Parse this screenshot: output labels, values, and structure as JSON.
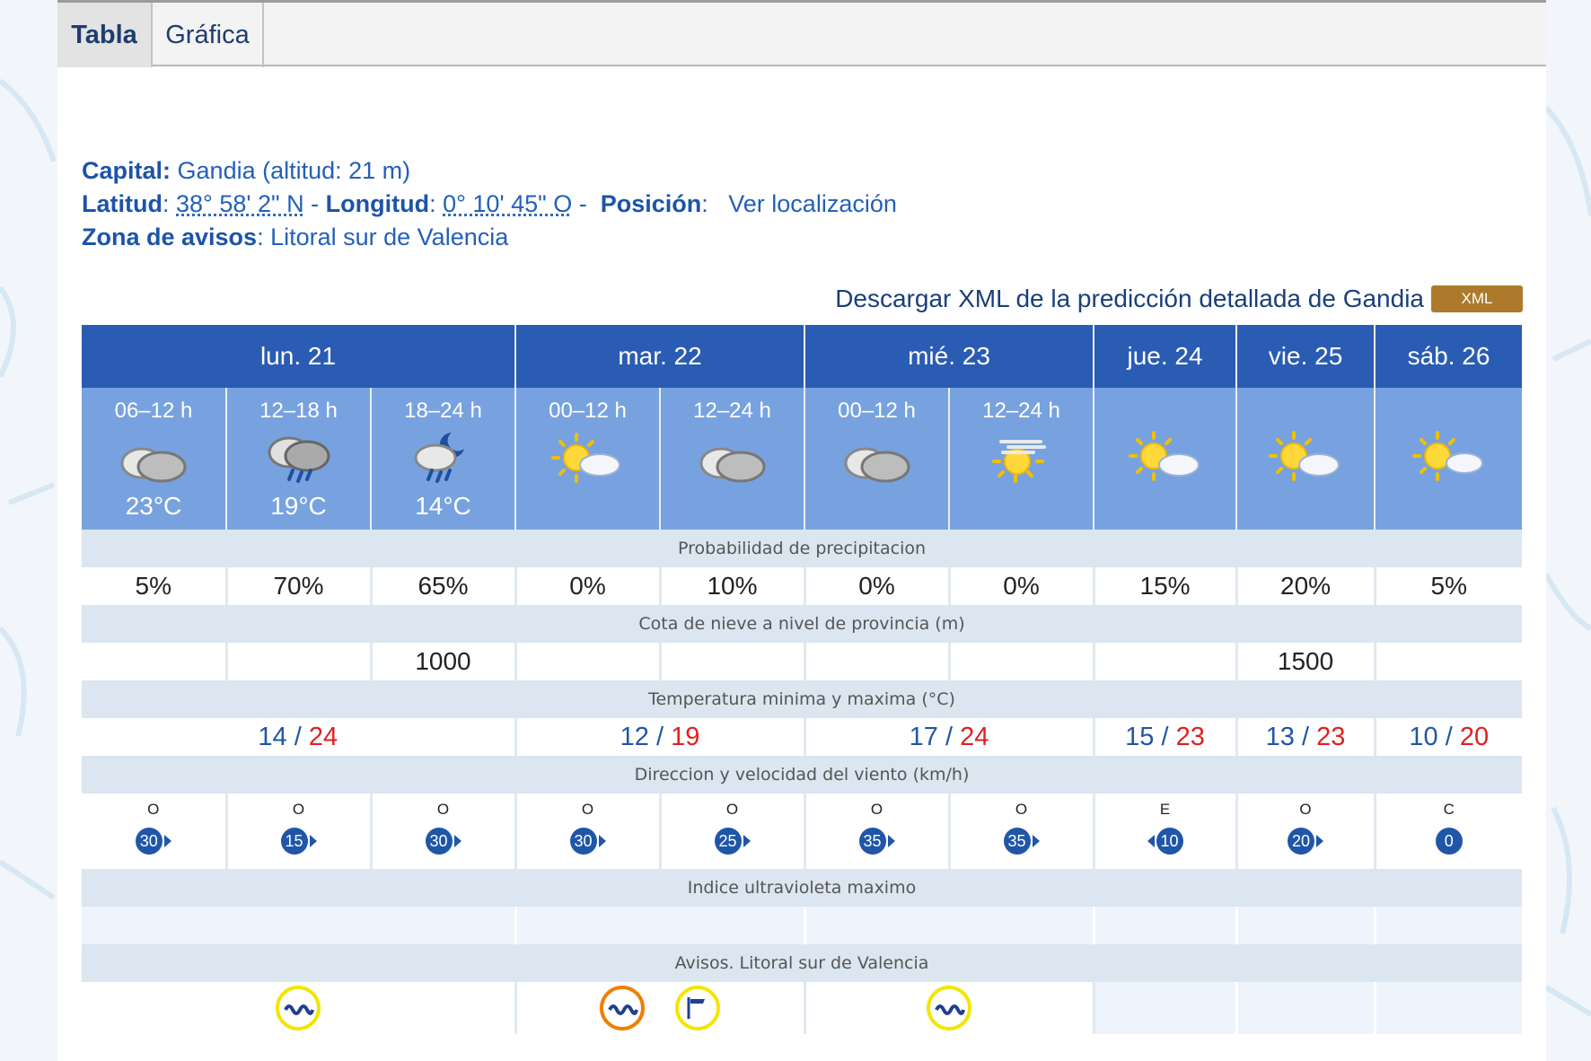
{
  "tabs": [
    {
      "label": "Tabla",
      "active": true
    },
    {
      "label": "Gráfica",
      "active": false
    }
  ],
  "info": {
    "capital_label": "Capital:",
    "capital_value": "Gandia (altitud: 21 m)",
    "latitud_label": "Latitud",
    "latitud_value": "38° 58' 2\" N",
    "longitud_label": "Longitud",
    "longitud_value": "0° 10' 45\" O",
    "posicion_label": "Posición",
    "posicion_link": "Ver localización",
    "zona_label": "Zona de avisos",
    "zona_value": "Litoral sur de Valencia"
  },
  "download": {
    "text": "Descargar XML de la predicción detallada de Gandia",
    "badge": "XML"
  },
  "days": [
    "lun. 21",
    "mar. 22",
    "mié. 23",
    "jue. 24",
    "vie. 25",
    "sáb. 26"
  ],
  "periods": [
    {
      "time": "06–12 h",
      "icon": "cloudy-icon",
      "temp": "23°C"
    },
    {
      "time": "12–18 h",
      "icon": "rain-storm-icon",
      "temp": "19°C"
    },
    {
      "time": "18–24 h",
      "icon": "night-rain-icon",
      "temp": "14°C"
    },
    {
      "time": "00–12 h",
      "icon": "sun-cloud-icon",
      "temp": ""
    },
    {
      "time": "12–24 h",
      "icon": "cloudy-icon",
      "temp": ""
    },
    {
      "time": "00–12 h",
      "icon": "cloudy-icon",
      "temp": ""
    },
    {
      "time": "12–24 h",
      "icon": "sun-haze-icon",
      "temp": ""
    },
    {
      "time": "",
      "icon": "sun-cloud-icon",
      "temp": ""
    },
    {
      "time": "",
      "icon": "sun-cloud-icon",
      "temp": ""
    },
    {
      "time": "",
      "icon": "sun-cloud-icon",
      "temp": ""
    }
  ],
  "sections": {
    "precip": "Probabilidad de precipitacion",
    "snow": "Cota de nieve a nivel de provincia (m)",
    "temp": "Temperatura minima y maxima (°C)",
    "wind": "Direccion y velocidad del viento (km/h)",
    "uv": "Indice ultravioleta maximo",
    "warnings": "Avisos. Litoral sur de Valencia"
  },
  "precip": [
    "5%",
    "70%",
    "65%",
    "0%",
    "10%",
    "0%",
    "0%",
    "15%",
    "20%",
    "5%"
  ],
  "snow": [
    "",
    "",
    "1000",
    "",
    "",
    "",
    "",
    "",
    "1500",
    ""
  ],
  "temps": [
    {
      "min": "14",
      "max": "24"
    },
    {
      "min": "12",
      "max": "19"
    },
    {
      "min": "17",
      "max": "24"
    },
    {
      "min": "15",
      "max": "23"
    },
    {
      "min": "13",
      "max": "23"
    },
    {
      "min": "10",
      "max": "20"
    }
  ],
  "temp_sep": "/",
  "wind": [
    {
      "dir": "O",
      "speed": "30"
    },
    {
      "dir": "O",
      "speed": "15"
    },
    {
      "dir": "O",
      "speed": "30"
    },
    {
      "dir": "O",
      "speed": "30"
    },
    {
      "dir": "O",
      "speed": "25"
    },
    {
      "dir": "O",
      "speed": "35"
    },
    {
      "dir": "O",
      "speed": "35"
    },
    {
      "dir": "E",
      "speed": "10"
    },
    {
      "dir": "O",
      "speed": "20"
    },
    {
      "dir": "C",
      "speed": "0"
    }
  ],
  "warnings": [
    [
      {
        "icon": "coastal-warning-icon",
        "color": "#f2e600"
      }
    ],
    [
      {
        "icon": "coastal-warning-icon",
        "color": "#f07e00"
      },
      {
        "icon": "wind-warning-icon",
        "color": "#f2e600"
      }
    ],
    [
      {
        "icon": "coastal-warning-icon",
        "color": "#f2e600"
      }
    ],
    [],
    [],
    []
  ],
  "colors": {
    "day_header": "#2b5cb3",
    "period_header": "#78a2df",
    "section_bg": "#dbe6f1",
    "temp_min": "#1f56a8",
    "temp_max": "#e02020",
    "xml_badge": "#ad7a2b"
  }
}
